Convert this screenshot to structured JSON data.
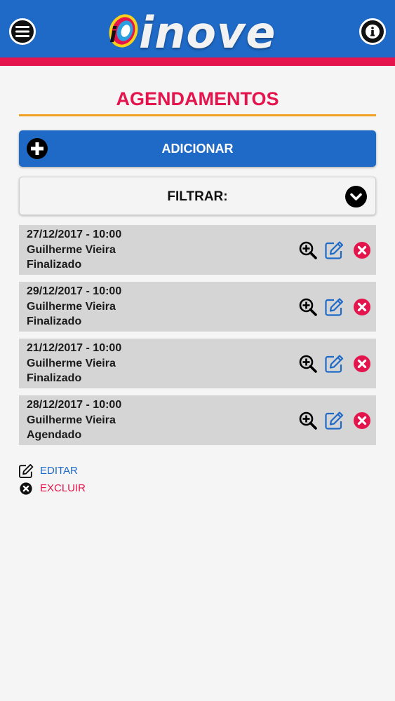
{
  "header": {
    "brand": "inove",
    "menu_icon": "hamburger-menu-icon",
    "info_icon": "info-icon",
    "colors": {
      "bar": "#1f6ac7",
      "stripe": "#e4144d"
    }
  },
  "page": {
    "title": "AGENDAMENTOS",
    "title_color": "#e4144d",
    "underline_color": "#f0a025"
  },
  "actions": {
    "add_label": "ADICIONAR",
    "add_icon": "plus-circle-icon",
    "filter_label": "FILTRAR:",
    "filter_icon": "chevron-down-circle-icon"
  },
  "appointments": [
    {
      "datetime": "27/12/2017 - 10:00",
      "name": "Guilherme Vieira",
      "status": "Finalizado"
    },
    {
      "datetime": "29/12/2017 - 10:00",
      "name": "Guilherme Vieira",
      "status": "Finalizado"
    },
    {
      "datetime": "21/12/2017 - 10:00",
      "name": "Guilherme Vieira",
      "status": "Finalizado"
    },
    {
      "datetime": "28/12/2017 - 10:00",
      "name": "Guilherme Vieira",
      "status": "Agendado"
    }
  ],
  "row_icons": {
    "view": "zoom-in-icon",
    "edit": "edit-icon",
    "delete": "delete-icon"
  },
  "legend": {
    "edit_label": "EDITAR",
    "delete_label": "EXCLUIR"
  }
}
